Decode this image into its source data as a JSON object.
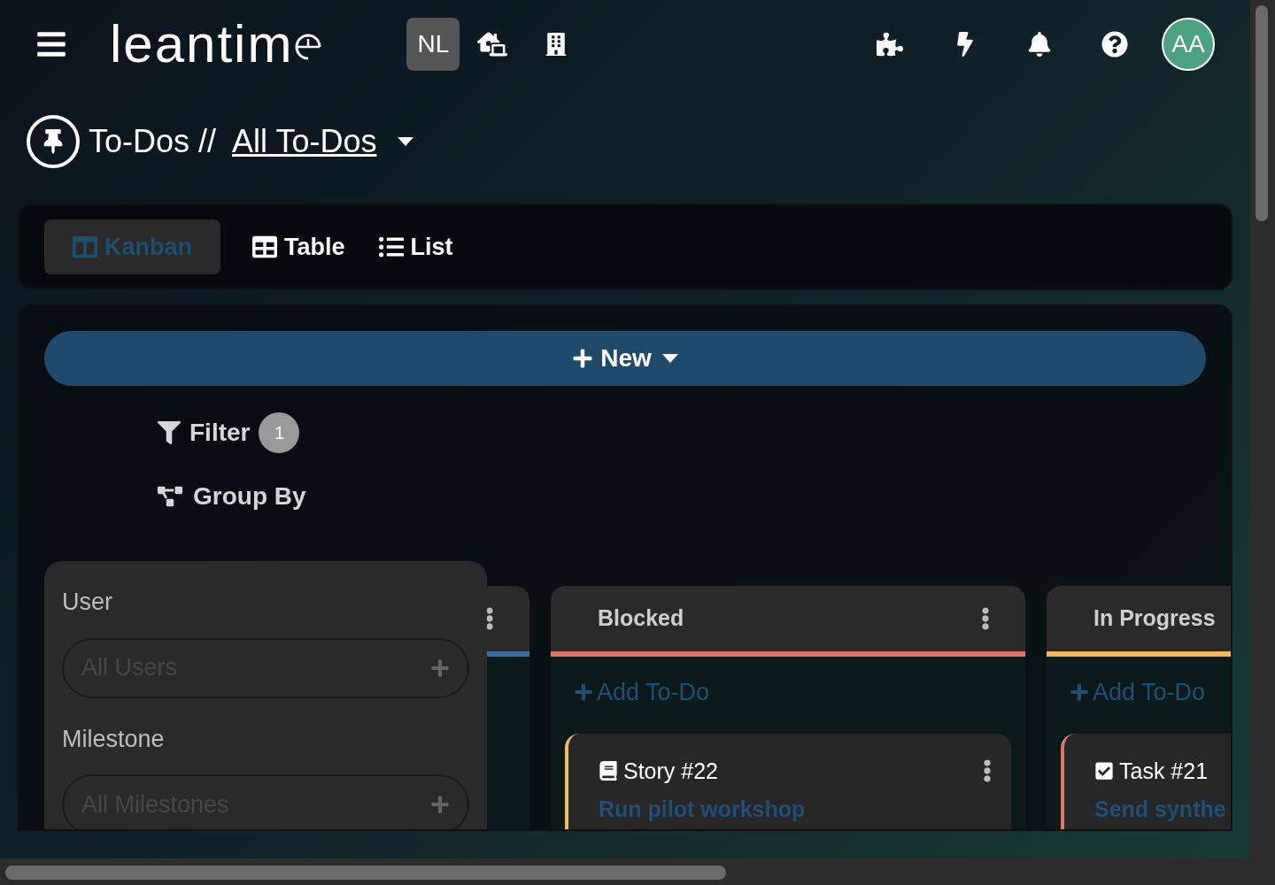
{
  "header": {
    "logo": "leantim",
    "workspace_badge": "NL",
    "avatar": "AA"
  },
  "breadcrumb": {
    "section": "To-Dos //",
    "current": "All To-Dos"
  },
  "view_tabs": [
    {
      "kind": "kanban",
      "label": "Kanban",
      "selected": true
    },
    {
      "kind": "table",
      "label": "Table",
      "selected": false
    },
    {
      "kind": "list",
      "label": "List",
      "selected": false
    }
  ],
  "new_button": "New",
  "filter": {
    "label": "Filter",
    "count": "1"
  },
  "group_by": "Group By",
  "filter_menu": {
    "fields": [
      {
        "label": "User",
        "placeholder": "All Users"
      },
      {
        "label": "Milestone",
        "placeholder": "All Milestones"
      }
    ]
  },
  "columns": [
    {
      "color": "#3d6ea0",
      "menu": true
    },
    {
      "title": "Blocked",
      "color": "#e0736a",
      "menu": true,
      "add_label": "Add To-Do",
      "cards": [
        {
          "kind": "story",
          "ref": "Story #22",
          "title": "Run pilot workshop",
          "color": "#f2c04e",
          "menu": true
        }
      ]
    },
    {
      "title": "In Progress",
      "color": "#f2b65a",
      "add_label": "Add To-Do",
      "cards": [
        {
          "kind": "task",
          "ref": "Task #21",
          "title": "Send synthe",
          "color": "#e0736a"
        }
      ]
    }
  ]
}
